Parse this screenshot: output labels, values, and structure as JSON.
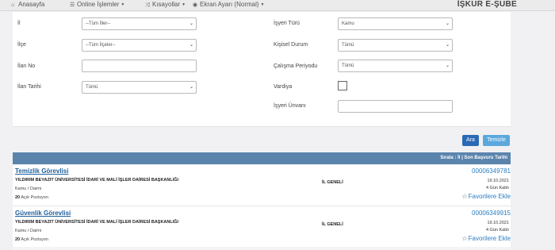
{
  "nav": {
    "items": [
      {
        "icon": "home-icon",
        "glyph": "⌂",
        "label": "Anasayfa",
        "dropdown": false
      },
      {
        "icon": "list-icon",
        "glyph": "☰",
        "label": "Online İşlemler",
        "dropdown": true
      },
      {
        "icon": "shuffle-icon",
        "glyph": "⤨",
        "label": "Kısayollar",
        "dropdown": true
      },
      {
        "icon": "eye-icon",
        "glyph": "◉",
        "label": "Ekran Ayarı (Normal)",
        "dropdown": true
      }
    ],
    "brand": "İŞKUR E-ŞUBE"
  },
  "filters": {
    "il": {
      "label": "İl",
      "value": "--Tüm İller--"
    },
    "ilce": {
      "label": "İlçe",
      "value": "--Tüm İlçeler--"
    },
    "ilan_no": {
      "label": "İlan No",
      "value": ""
    },
    "ilan_tarihi": {
      "label": "İlan Tarihi",
      "value": "Tümü"
    },
    "isyeri_turu": {
      "label": "İşyeri Türü",
      "value": "Kamu"
    },
    "kisisel_durum": {
      "label": "Kişisel Durum",
      "value": "Tümü"
    },
    "calisma_periyodu": {
      "label": "Çalışma Periyodu",
      "value": "Tümü"
    },
    "vardiya": {
      "label": "Vardiya",
      "checked": false
    },
    "isyeri_unvani": {
      "label": "İşyeri Ünvanı",
      "value": ""
    }
  },
  "buttons": {
    "search": "Ara",
    "clear": "Temizle"
  },
  "results": {
    "sort_label": "Sırala : İl | Son Başvuru Tarihi",
    "cards": [
      {
        "title": "Temizlik Görevlisi",
        "org": "YILDIRIM BEYAZIT ÜNİVERSİTESİ İDARİ VE MALİ İŞLER DAİRESİ BAŞKANLIĞI",
        "type": "Kamu / Daimi",
        "positions": "20",
        "positions_suffix": "Açık Pozisyon",
        "region": "İL GENELİ",
        "id": "00006349781",
        "date": "19.10.2021",
        "days_left": "4 Gün Kaldı",
        "fav": "Favorilere Ekle"
      },
      {
        "title": "Güvenlik Görevlisi",
        "org": "YILDIRIM BEYAZIT ÜNİVERSİTESİ İDARİ VE MALİ İŞLER DAİRESİ BAŞKANLIĞI",
        "type": "Kamu / Daimi",
        "positions": "20",
        "positions_suffix": "Açık Pozisyon",
        "region": "İL GENELİ",
        "id": "00006349915",
        "date": "19.10.2021",
        "days_left": "4 Gün Kaldı",
        "fav": "Favorilere Ekle"
      }
    ]
  }
}
